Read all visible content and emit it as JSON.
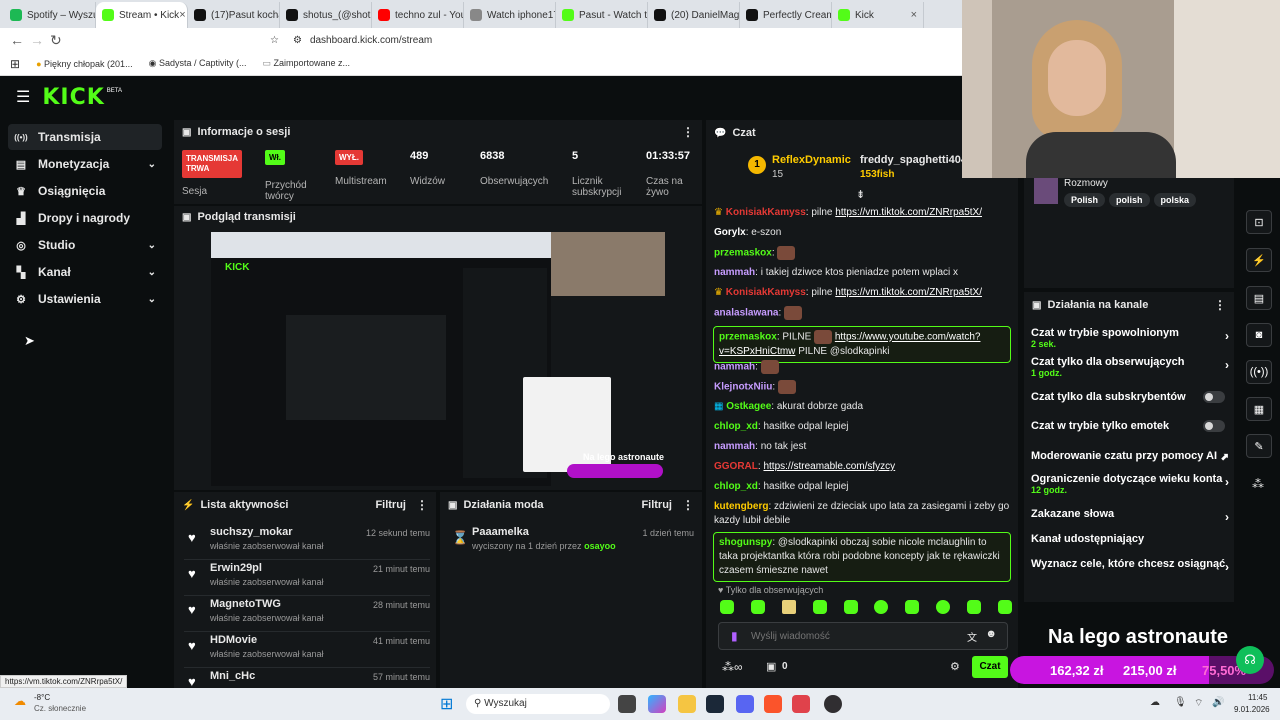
{
  "browser": {
    "tabs": [
      {
        "label": "Spotify – Wyszuk",
        "color": "#1db954"
      },
      {
        "label": "Stream • Kick",
        "color": "#53fc18",
        "active": true
      },
      {
        "label": "(17)Pasut kocha",
        "color": "#111111"
      },
      {
        "label": "shotus_(@shot",
        "color": "#111111"
      },
      {
        "label": "techno zul - You",
        "color": "#ff0000"
      },
      {
        "label": "Watch iphone17",
        "color": "#888888"
      },
      {
        "label": "Pasut - Watch th",
        "color": "#53fc18"
      },
      {
        "label": "(20) DanielMagic",
        "color": "#111111"
      },
      {
        "label": "Perfectly Creamy",
        "color": "#111111"
      },
      {
        "label": "Kick",
        "color": "#53fc18"
      }
    ],
    "url": "dashboard.kick.com/stream",
    "bookmarks": [
      "Piękny chłopak (201...",
      "Sadysta / Captivity (...",
      "Zaimportowane z..."
    ]
  },
  "kick": {
    "logo": "KICK",
    "beta": "BETA"
  },
  "sidebar": {
    "items": [
      {
        "label": "Transmisja",
        "icon": "broadcast-icon"
      },
      {
        "label": "Monetyzacja",
        "icon": "money-icon"
      },
      {
        "label": "Osiągnięcia",
        "icon": "trophy-icon"
      },
      {
        "label": "Dropy i nagrody",
        "icon": "gift-icon"
      },
      {
        "label": "Studio",
        "icon": "camera-icon"
      },
      {
        "label": "Kanał",
        "icon": "channel-icon"
      },
      {
        "label": "Ustawienia",
        "icon": "gear-icon"
      }
    ]
  },
  "session": {
    "title": "Informacje o sesji",
    "live_badge_line1": "TRANSMISJA",
    "live_badge_line2": "TRWA",
    "live_sub": "Sesja",
    "income_badge": "Wł.",
    "income_label": "Przychód twórcy",
    "multistream_badge": "WYŁ.",
    "multistream_label": "Multistream",
    "viewers": "489",
    "viewers_label": "Widzów",
    "followers": "6838",
    "followers_label": "Obserwujących",
    "subs": "5",
    "subs_label": "Licznik subskrypcji",
    "time": "01:33:57",
    "time_label": "Czas na żywo"
  },
  "preview": {
    "title": "Podgląd transmisji"
  },
  "activity": {
    "title": "Lista aktywności",
    "filter": "Filtruj",
    "items": [
      {
        "name": "suchszy_mokar",
        "sub": "właśnie zaobserwował kanał",
        "time": "12 sekund temu"
      },
      {
        "name": "Erwin29pl",
        "sub": "właśnie zaobserwował kanał",
        "time": "21 minut temu"
      },
      {
        "name": "MagnetoTWG",
        "sub": "właśnie zaobserwował kanał",
        "time": "28 minut temu"
      },
      {
        "name": "HDMovie",
        "sub": "właśnie zaobserwował kanał",
        "time": "41 minut temu"
      },
      {
        "name": "Mni_cHc",
        "sub": "",
        "time": "57 minut temu"
      }
    ]
  },
  "modactions": {
    "title": "Działania moda",
    "filter": "Filtruj",
    "item_name": "Paaamelka",
    "item_sub": "wyciszony na 1 dzień przez",
    "item_by": "osayoo",
    "item_time": "1 dzień temu"
  },
  "chat": {
    "title": "Czat",
    "top1_name": "ReflexDynamic",
    "top1_count": "15",
    "top2_name": "freddy_spaghetti404",
    "top2_amount": "153fish",
    "messages": [
      {
        "user": "KonisiakKamyss",
        "color": "#e53935",
        "text": "pilne",
        "link": "https://vm.tiktok.com/ZNRrpa5tX/"
      },
      {
        "user": "Gorylx",
        "color": "#ffffff",
        "text": "e-szon",
        "link": ""
      },
      {
        "user": "przemaskox",
        "color": "#53fc18",
        "text": "",
        "link": ""
      },
      {
        "user": "nammah",
        "color": "#c79cff",
        "text": "i takiej dziwce ktos pieniadze potem wplaci x",
        "link": ""
      },
      {
        "user": "KonisiakKamyss",
        "color": "#e53935",
        "text": "pilne",
        "link": "https://vm.tiktok.com/ZNRrpa5tX/"
      },
      {
        "user": "analaslawana",
        "color": "#c79cff",
        "text": "",
        "link": ""
      },
      {
        "user": "przemaskox",
        "color": "#53fc18",
        "text": "PILNE",
        "link": "https://www.youtube.com/watch?v=KSPxHniCtmw",
        "after": "PILNE @slodkapinki"
      },
      {
        "user": "nammah",
        "color": "#c79cff",
        "text": "",
        "link": ""
      },
      {
        "user": "KlejnotxNiiu",
        "color": "#c79cff",
        "text": "",
        "link": ""
      },
      {
        "user": "Ostkagee",
        "color": "#53fc18",
        "text": "akurat dobrze gada",
        "link": ""
      },
      {
        "user": "chlop_xd",
        "color": "#53fc18",
        "text": "hasitke odpal lepiej",
        "link": ""
      },
      {
        "user": "nammah",
        "color": "#c79cff",
        "text": "no tak jest",
        "link": ""
      },
      {
        "user": "GGORAL",
        "color": "#e53935",
        "text": "",
        "link": "https://streamable.com/sfyzcy"
      },
      {
        "user": "chlop_xd",
        "color": "#53fc18",
        "text": "hasitke odpal lepiej",
        "link": ""
      },
      {
        "user": "kutengberg",
        "color": "#ffcc00",
        "text": "zdziwieni ze dzieciak upo lata za zasiegami i zeby go kazdy lubił debile",
        "link": ""
      },
      {
        "user": "shogunspy",
        "color": "#53fc18",
        "text": "@slodkapinki obczaj sobie nicole mclaughlin to taka projektantka która robi podobne koncepty jak te rękawiczki czasem śmieszne nawet",
        "link": ""
      }
    ],
    "followers_only": "Tylko dla obserwujących",
    "input_placeholder": "Wyślij wiadomość",
    "points": "0",
    "send": "Czat"
  },
  "stream_tags": {
    "title": "Rozmowy",
    "tags": [
      "Polish",
      "polish",
      "polska"
    ]
  },
  "channel_actions": {
    "title": "Działania na kanale",
    "items": [
      {
        "label": "Czat w trybie spowolnionym",
        "sub": "2 sek.",
        "type": "chevron"
      },
      {
        "label": "Czat tylko dla obserwujących",
        "sub": "1 godz.",
        "type": "chevron"
      },
      {
        "label": "Czat tylko dla subskrybentów",
        "sub": "",
        "type": "toggle"
      },
      {
        "label": "Czat w trybie tylko emotek",
        "sub": "",
        "type": "toggle"
      },
      {
        "label": "Moderowanie czatu przy pomocy AI",
        "sub": "",
        "type": "external"
      },
      {
        "label": "Ograniczenie dotyczące wieku konta",
        "sub": "12 godz.",
        "type": "chevron"
      },
      {
        "label": "Zakazane słowa",
        "sub": "",
        "type": "chevron"
      },
      {
        "label": "Kanał udostępniający",
        "sub": "",
        "type": "none"
      },
      {
        "label": "Wyznacz cele, które chcesz osiągnąć",
        "sub": "",
        "type": "chevron"
      }
    ]
  },
  "overlay": {
    "headline": "Na lego astronaute",
    "amount1": "162,32 zł",
    "amount2": "215,00 zł",
    "amount3": "75,50%"
  },
  "statusbar_url": "https://vm.tiktok.com/ZNRrpa5tX/",
  "taskbar": {
    "temp": "-8°C",
    "weather": "Cz. słonecznie",
    "search": "Wyszukaj",
    "time": "11:45",
    "date": "9.01.2026"
  }
}
